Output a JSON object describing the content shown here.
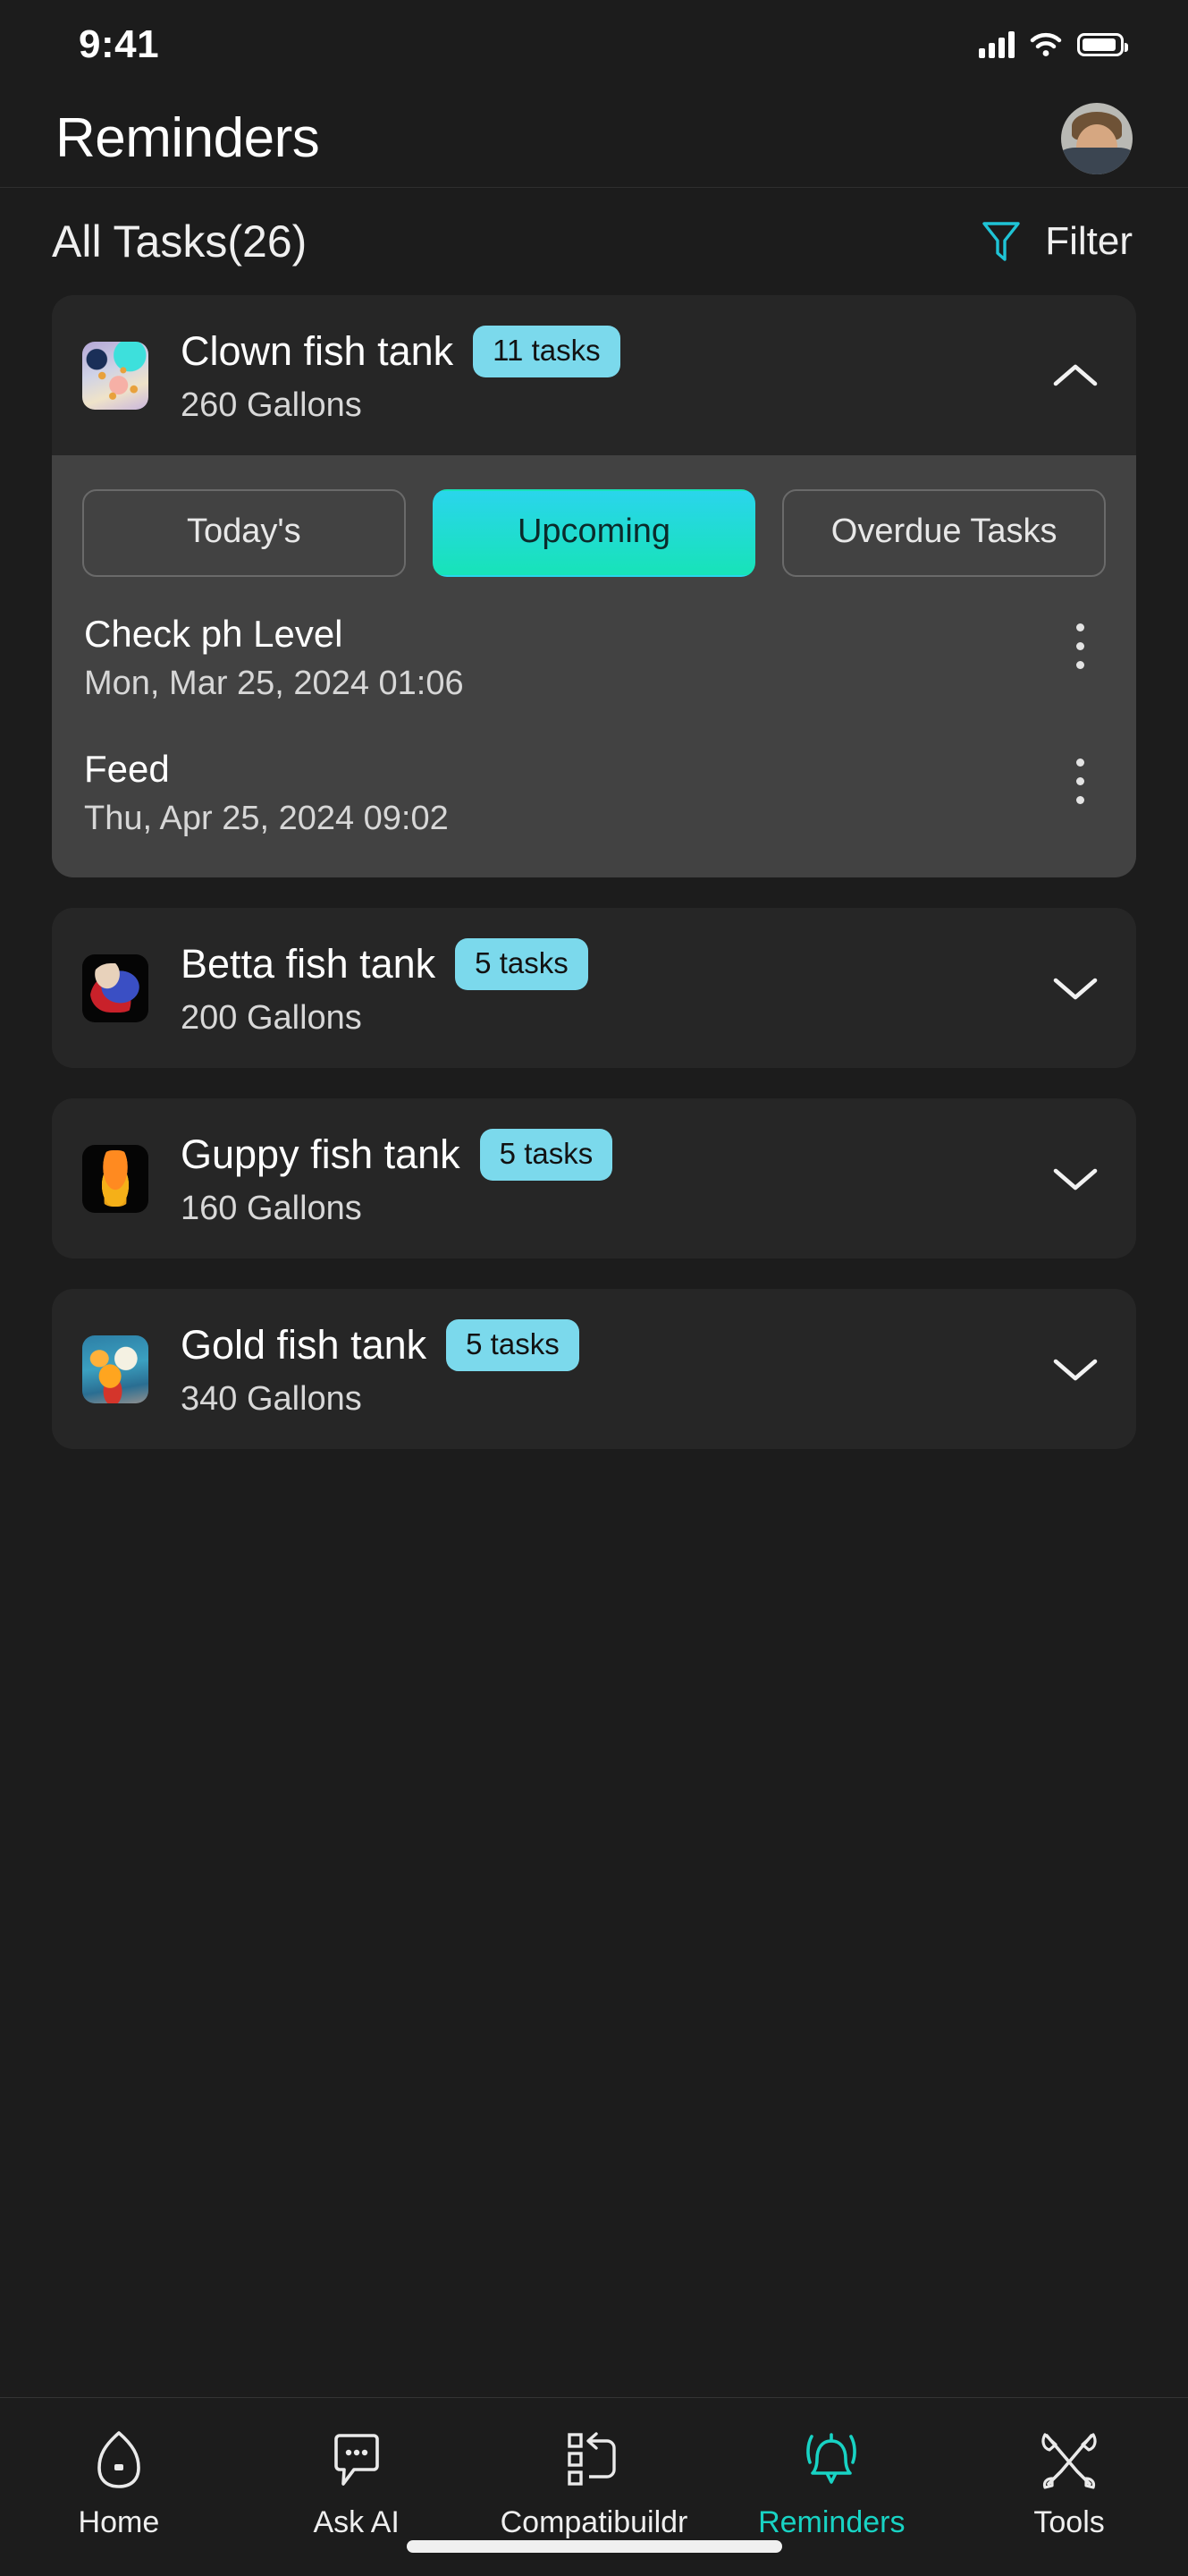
{
  "status_bar": {
    "time": "9:41",
    "signal_icon": "cellular-signal-icon",
    "wifi_icon": "wifi-icon",
    "battery_icon": "battery-icon"
  },
  "header": {
    "title": "Reminders",
    "avatar_name": "user-avatar"
  },
  "tasks_summary": {
    "title": "All Tasks(26)",
    "filter_label": "Filter",
    "filter_icon": "funnel-filter-icon",
    "filter_color": "#1fc4d6"
  },
  "colors": {
    "background": "#1c1c1c",
    "card": "#262626",
    "panel": "#424242",
    "badge": "#7bd9ec",
    "accent": "#18d3c4",
    "gradient_start": "#2ad5ec",
    "gradient_end": "#17e3b8"
  },
  "tanks": [
    {
      "name": "Clown fish tank",
      "gallons": "260 Gallons",
      "badge": "11 tasks",
      "expanded": true,
      "chevron_icon": "chevron-up-icon",
      "thumb": "clown-fish-thumbnail",
      "tabs": [
        {
          "label": "Today's",
          "active": false
        },
        {
          "label": "Upcoming",
          "active": true
        },
        {
          "label": "Overdue Tasks",
          "active": false
        }
      ],
      "tasks": [
        {
          "name": "Check ph Level",
          "date": "Mon, Mar 25, 2024 01:06",
          "menu_icon": "kebab-menu-icon"
        },
        {
          "name": "Feed",
          "date": "Thu, Apr 25, 2024 09:02",
          "menu_icon": "kebab-menu-icon"
        }
      ]
    },
    {
      "name": "Betta fish tank",
      "gallons": "200 Gallons",
      "badge": "5 tasks",
      "expanded": false,
      "chevron_icon": "chevron-down-icon",
      "thumb": "betta-fish-thumbnail"
    },
    {
      "name": "Guppy fish tank",
      "gallons": "160 Gallons",
      "badge": "5 tasks",
      "expanded": false,
      "chevron_icon": "chevron-down-icon",
      "thumb": "guppy-fish-thumbnail"
    },
    {
      "name": "Gold fish tank",
      "gallons": "340 Gallons",
      "badge": "5 tasks",
      "expanded": false,
      "chevron_icon": "chevron-down-icon",
      "thumb": "gold-fish-thumbnail"
    }
  ],
  "tabbar": {
    "items": [
      {
        "label": "Home",
        "icon": "home-icon",
        "active": false
      },
      {
        "label": "Ask AI",
        "icon": "chat-bubble-icon",
        "active": false
      },
      {
        "label": "Compatibuildr",
        "icon": "compatibility-list-icon",
        "active": false
      },
      {
        "label": "Reminders",
        "icon": "bell-icon",
        "active": true
      },
      {
        "label": "Tools",
        "icon": "tools-icon",
        "active": false
      }
    ]
  }
}
